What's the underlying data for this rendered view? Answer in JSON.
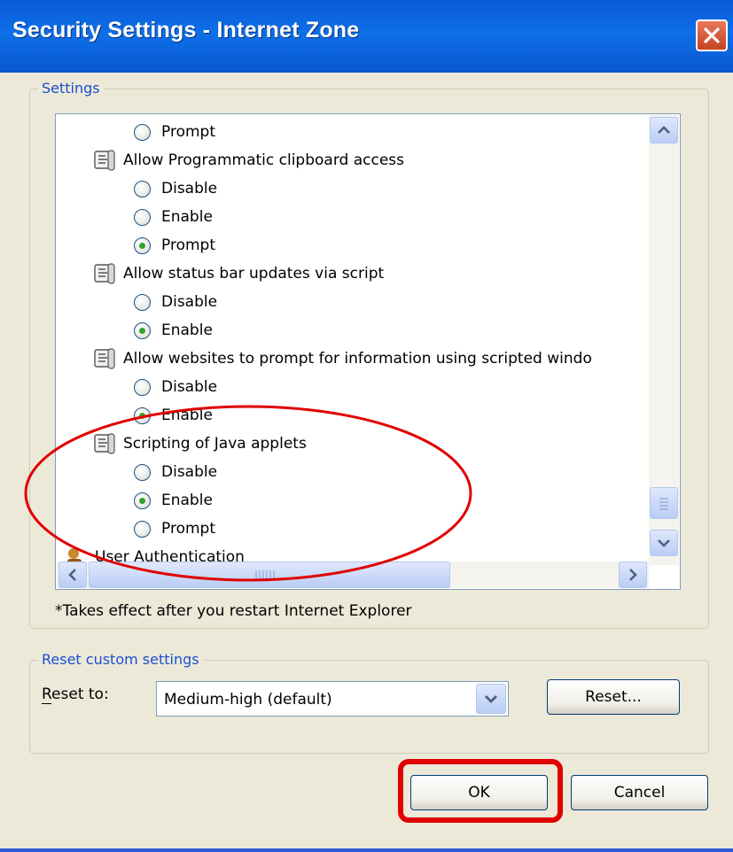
{
  "window": {
    "title": "Security Settings - Internet Zone"
  },
  "settings_group": {
    "label": "Settings",
    "rows": [
      {
        "kind": "option",
        "label": "Prompt",
        "checked": false
      },
      {
        "kind": "setting",
        "label": "Allow Programmatic clipboard access",
        "icon": "settings-scroll-icon"
      },
      {
        "kind": "option",
        "label": "Disable",
        "checked": false
      },
      {
        "kind": "option",
        "label": "Enable",
        "checked": false
      },
      {
        "kind": "option",
        "label": "Prompt",
        "checked": true
      },
      {
        "kind": "setting",
        "label": "Allow status bar updates via script",
        "icon": "settings-scroll-icon"
      },
      {
        "kind": "option",
        "label": "Disable",
        "checked": false
      },
      {
        "kind": "option",
        "label": "Enable",
        "checked": true
      },
      {
        "kind": "setting",
        "label": "Allow websites to prompt for information using scripted windo",
        "icon": "settings-scroll-icon"
      },
      {
        "kind": "option",
        "label": "Disable",
        "checked": false
      },
      {
        "kind": "option",
        "label": "Enable",
        "checked": true
      },
      {
        "kind": "setting",
        "label": "Scripting of Java applets",
        "icon": "settings-scroll-icon"
      },
      {
        "kind": "option",
        "label": "Disable",
        "checked": false
      },
      {
        "kind": "option",
        "label": "Enable",
        "checked": true
      },
      {
        "kind": "option",
        "label": "Prompt",
        "checked": false
      },
      {
        "kind": "category",
        "label": "User Authentication",
        "icon": "user-auth-icon"
      }
    ],
    "note": "*Takes effect after you restart Internet Explorer"
  },
  "reset_group": {
    "label": "Reset custom settings",
    "reset_to_label": "Reset to:",
    "selected": "Medium-high (default)",
    "reset_button": "Reset..."
  },
  "buttons": {
    "ok": "OK",
    "cancel": "Cancel"
  },
  "colors": {
    "title_bar": "#0a5ad6",
    "group_label": "#1a4fd2",
    "annotation": "#e00000",
    "radio_checked": "#2fa52f"
  }
}
